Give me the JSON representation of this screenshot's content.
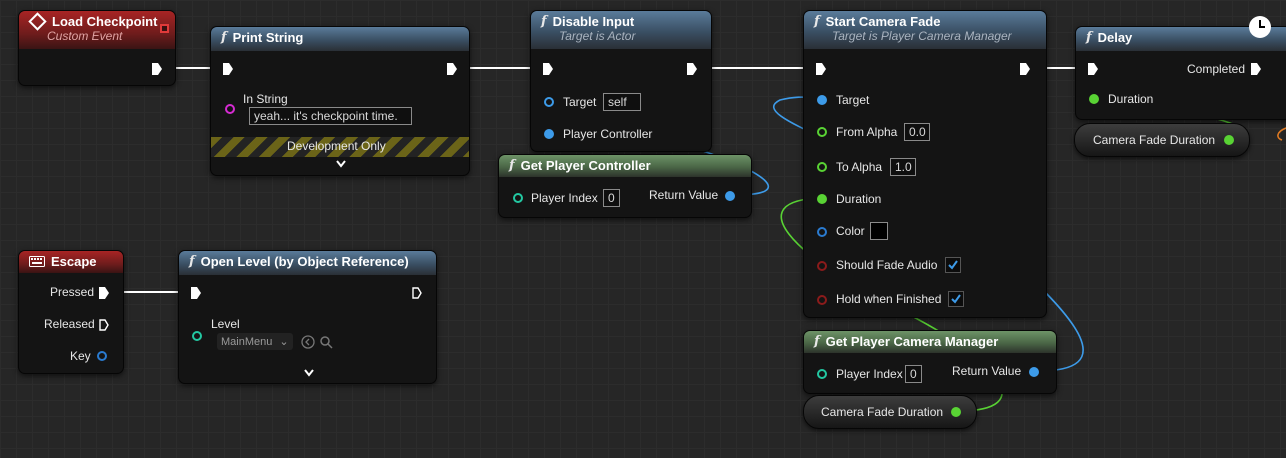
{
  "nodes": {
    "load_checkpoint": {
      "title": "Load Checkpoint",
      "subtitle": "Custom Event"
    },
    "print_string": {
      "title": "Print String",
      "in_string_label": "In String",
      "in_string_value": "yeah... it's checkpoint time.",
      "dev_only": "Development Only"
    },
    "disable_input": {
      "title": "Disable Input",
      "subtitle": "Target is Actor",
      "target_label": "Target",
      "target_value": "self",
      "player_controller_label": "Player Controller"
    },
    "get_player_controller": {
      "title": "Get Player Controller",
      "player_index_label": "Player Index",
      "player_index_value": "0",
      "return_label": "Return Value"
    },
    "start_camera_fade": {
      "title": "Start Camera Fade",
      "subtitle": "Target is Player Camera Manager",
      "target_label": "Target",
      "from_alpha_label": "From Alpha",
      "from_alpha_value": "0.0",
      "to_alpha_label": "To Alpha",
      "to_alpha_value": "1.0",
      "duration_label": "Duration",
      "color_label": "Color",
      "should_fade_audio_label": "Should Fade Audio",
      "should_fade_audio": true,
      "hold_label": "Hold when Finished",
      "hold": true
    },
    "get_player_camera_manager": {
      "title": "Get Player Camera Manager",
      "player_index_label": "Player Index",
      "player_index_value": "0",
      "return_label": "Return Value"
    },
    "camera_fade_duration_var_1": {
      "label": "Camera Fade Duration"
    },
    "camera_fade_duration_var_2": {
      "label": "Camera Fade Duration"
    },
    "delay": {
      "title": "Delay",
      "completed_label": "Completed",
      "duration_label": "Duration"
    },
    "escape": {
      "title": "Escape",
      "pressed_label": "Pressed",
      "released_label": "Released",
      "key_label": "Key"
    },
    "open_level": {
      "title": "Open Level (by Object Reference)",
      "level_label": "Level",
      "level_value": "MainMenu"
    }
  },
  "colors": {
    "exec": "#ffffff",
    "object": "#3d9be9",
    "float": "#59d334",
    "string": "#d62bd2",
    "struct": "#2a7bd0",
    "bool": "#8b1b1b",
    "event_header": "#a82424",
    "function_header": "#3a4f63",
    "pure_header": "#4a6646"
  },
  "icons": [
    "event-diamond-icon",
    "function-icon",
    "keyboard-icon",
    "clock-icon",
    "chevron-down-icon",
    "browse-icon",
    "search-icon"
  ]
}
